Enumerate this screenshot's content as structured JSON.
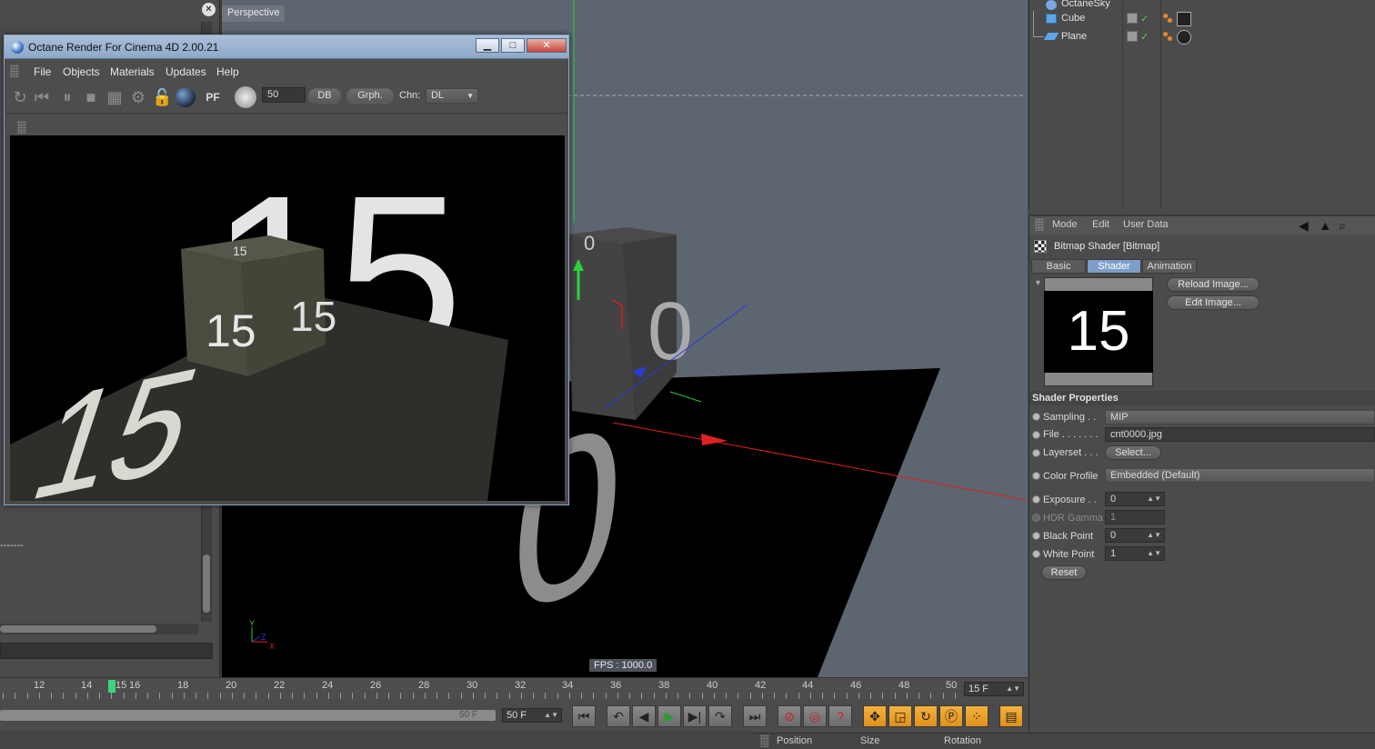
{
  "left_panel": {
    "close_glyph": "×",
    "dashes": "-------"
  },
  "viewport": {
    "label": "Perspective",
    "fps": "FPS : 1000.0",
    "axis_y": "Y",
    "axis_z": "Z",
    "axis_x": "X",
    "cube_top_digit": "0",
    "cube_side_digit": "0",
    "floor_digit": "0"
  },
  "octane": {
    "title": "Octane Render For Cinema 4D 2.00.21",
    "min_glyph": "▁",
    "max_glyph": "□",
    "close_glyph": "✕",
    "menu": [
      "File",
      "Objects",
      "Materials",
      "Updates",
      "Help"
    ],
    "toolbar": {
      "icons": [
        "restart-icon",
        "stop-icon",
        "pause-icon",
        "region-icon",
        "resolution-icon",
        "settings-icon",
        "lock-icon",
        "material-ball-icon",
        "pf-icon",
        "pick-icon"
      ],
      "spin_value": "50",
      "db_label": "DB",
      "grph_label": "Grph.",
      "chn_label": "Chn:",
      "chn_value": "DL"
    },
    "render": {
      "cube_front": "15",
      "cube_side": "15",
      "cube_top": "15",
      "floor_text": "15",
      "bg_text": "15"
    }
  },
  "objects": {
    "rows": [
      {
        "name": "OctaneSky"
      },
      {
        "name": "Cube"
      },
      {
        "name": "Plane"
      }
    ]
  },
  "attributes": {
    "menu": [
      "Mode",
      "Edit",
      "User Data"
    ],
    "title": "Bitmap Shader [Bitmap]",
    "tabs": [
      "Basic",
      "Shader",
      "Animation"
    ],
    "preview_text": "15",
    "reload_label": "Reload Image...",
    "edit_label": "Edit Image...",
    "props_header": "Shader Properties",
    "sampling_label": "Sampling . .",
    "sampling_value": "MIP",
    "file_label": "File . . . . . . .",
    "file_value": "cnt0000.jpg",
    "layerset_label": "Layerset . . .",
    "layerset_value": "Select...",
    "color_profile_label": "Color Profile",
    "color_profile_value": "Embedded (Default)",
    "exposure_label": "Exposure . .",
    "exposure_value": "0",
    "hdr_label": "HDR Gamma",
    "hdr_value": "1",
    "black_label": "Black Point",
    "black_value": "0",
    "white_label": "White Point",
    "white_value": "1",
    "reset_label": "Reset"
  },
  "timeline": {
    "ticks": [
      "12",
      "14",
      "16",
      "18",
      "20",
      "22",
      "24",
      "26",
      "28",
      "30",
      "32",
      "34",
      "36",
      "38",
      "40",
      "42",
      "44",
      "46",
      "48",
      "50"
    ],
    "current": "15",
    "end_frame": "15 F"
  },
  "transport": {
    "range_label": "50 F",
    "range_end": "50 F"
  },
  "coords": {
    "position": "Position",
    "size": "Size",
    "rotation": "Rotation"
  },
  "colors": {
    "accent": "#7d9ec8",
    "timeline_marker": "#3fd27f",
    "axis_red": "#e02020",
    "axis_green": "#2bd23b",
    "axis_blue": "#2a3ad8"
  }
}
